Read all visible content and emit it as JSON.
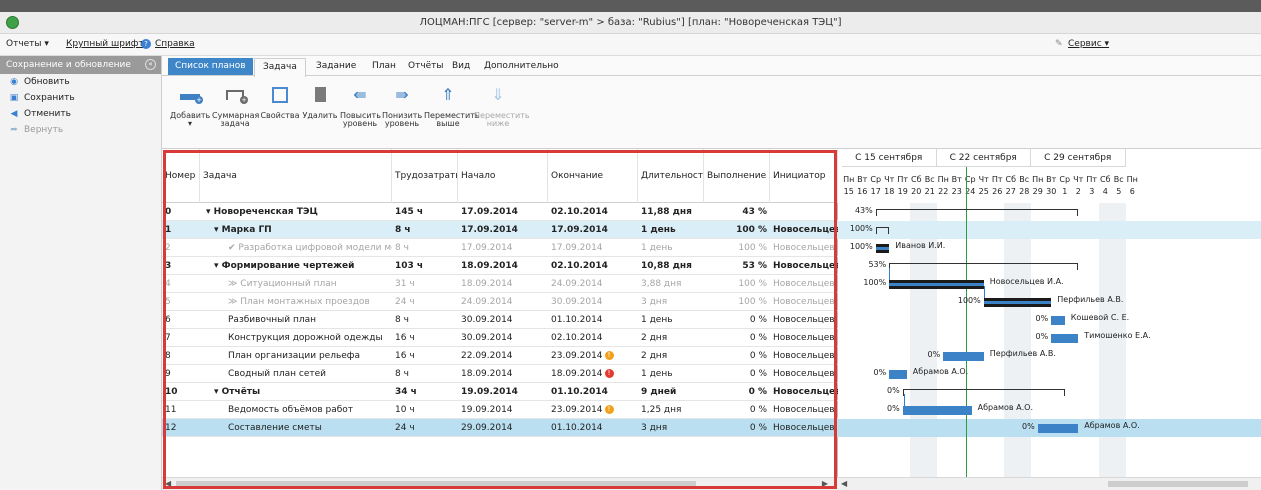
{
  "window": {
    "title": "ЛОЦМАН:ПГС   [сервер: \"server-m\" > база: \"Rubius\"]    [план: \"Новореченская ТЭЦ\"]"
  },
  "menubar": {
    "reports": "Отчеты ▾",
    "large_font": "Крупный шрифт",
    "help": "Справка",
    "service": "Сервис ▾"
  },
  "left_panel": {
    "header": "Сохранение и обновление",
    "items": [
      {
        "label": "Обновить",
        "icon": "refresh-icon"
      },
      {
        "label": "Сохранить",
        "icon": "save-icon"
      },
      {
        "label": "Отменить",
        "icon": "undo-icon"
      },
      {
        "label": "Вернуть",
        "icon": "redo-icon"
      }
    ]
  },
  "ribbon": {
    "tabs": [
      "Список планов",
      "Задача",
      "Задание",
      "План",
      "Отчёты",
      "Вид",
      "Дополнительно"
    ],
    "buttons": [
      {
        "l1": "Добавить",
        "l2": "▾"
      },
      {
        "l1": "Суммарная",
        "l2": "задача"
      },
      {
        "l1": "Свойства",
        "l2": ""
      },
      {
        "l1": "Удалить",
        "l2": ""
      },
      {
        "l1": "Повысить",
        "l2": "уровень"
      },
      {
        "l1": "Понизить",
        "l2": "уровень"
      },
      {
        "l1": "Переместить",
        "l2": "выше"
      },
      {
        "l1": "Переместить",
        "l2": "ниже"
      }
    ]
  },
  "grid": {
    "columns": [
      "Номер",
      "Задача",
      "Трудозатраты",
      "Начало",
      "Окончание",
      "Длительность",
      "Выполнение %",
      "Инициатор"
    ],
    "rows": [
      {
        "num": "0",
        "task": "▾ Новореченская ТЭЦ",
        "effort": "145 ч",
        "start": "17.09.2014",
        "end": "02.10.2014",
        "dur": "11,88 дня",
        "pct": "43 %",
        "init": ""
      },
      {
        "num": "1",
        "task": "▾ Марка ГП",
        "effort": "8 ч",
        "start": "17.09.2014",
        "end": "17.09.2014",
        "dur": "1 день",
        "pct": "100 %",
        "init": "Новосельцев"
      },
      {
        "num": "2",
        "task": "✔ Разработка цифровой модели местности",
        "effort": "8 ч",
        "start": "17.09.2014",
        "end": "17.09.2014",
        "dur": "1 день",
        "pct": "100 %",
        "init": "Новосельцев"
      },
      {
        "num": "3",
        "task": "▾ Формирование чертежей",
        "effort": "103 ч",
        "start": "18.09.2014",
        "end": "02.10.2014",
        "dur": "10,88 дня",
        "pct": "53 %",
        "init": "Новосельцев"
      },
      {
        "num": "4",
        "task": "≫ Ситуационный план",
        "effort": "31 ч",
        "start": "18.09.2014",
        "end": "24.09.2014",
        "dur": "3,88 дня",
        "pct": "100 %",
        "init": "Новосельцев"
      },
      {
        "num": "5",
        "task": "≫ План монтажных проездов",
        "effort": "24 ч",
        "start": "24.09.2014",
        "end": "30.09.2014",
        "dur": "3 дня",
        "pct": "100 %",
        "init": "Новосельцев"
      },
      {
        "num": "6",
        "task": "Разбивочный план",
        "effort": "8 ч",
        "start": "30.09.2014",
        "end": "01.10.2014",
        "dur": "1 день",
        "pct": "0 %",
        "init": "Новосельцев"
      },
      {
        "num": "7",
        "task": "Конструкция дорожной одежды",
        "effort": "16 ч",
        "start": "30.09.2014",
        "end": "02.10.2014",
        "dur": "2 дня",
        "pct": "0 %",
        "init": "Новосельцев"
      },
      {
        "num": "8",
        "task": "План организации рельефа",
        "effort": "16 ч",
        "start": "22.09.2014",
        "end": "23.09.2014",
        "dur": "2 дня",
        "pct": "0 %",
        "init": "Новосельцев"
      },
      {
        "num": "9",
        "task": "Сводный план сетей",
        "effort": "8 ч",
        "start": "18.09.2014",
        "end": "18.09.2014",
        "dur": "1 день",
        "pct": "0 %",
        "init": "Новосельцев"
      },
      {
        "num": "10",
        "task": "▾ Отчёты",
        "effort": "34 ч",
        "start": "19.09.2014",
        "end": "01.10.2014",
        "dur": "9 дней",
        "pct": "0 %",
        "init": "Новосельцев"
      },
      {
        "num": "11",
        "task": "Ведомость объёмов работ",
        "effort": "10 ч",
        "start": "19.09.2014",
        "end": "23.09.2014",
        "dur": "1,25 дня",
        "pct": "0 %",
        "init": "Новосельцев"
      },
      {
        "num": "12",
        "task": "Составление сметы",
        "effort": "24 ч",
        "start": "29.09.2014",
        "end": "01.10.2014",
        "dur": "3 дня",
        "pct": "0 %",
        "init": "Новосельцев"
      }
    ]
  },
  "gantt": {
    "weeks": [
      "С 15 сентября",
      "С 22 сентября",
      "С 29 сентября"
    ],
    "day_names": [
      "Пн",
      "Вт",
      "Ср",
      "Чт",
      "Пт",
      "Сб",
      "Вс",
      "Пн",
      "Вт",
      "Ср",
      "Чт",
      "Пт",
      "Сб",
      "Вс",
      "Пн",
      "Вт",
      "Ср",
      "Чт",
      "Пт",
      "Сб",
      "Вс",
      "Пн"
    ],
    "day_nums": [
      "15",
      "16",
      "17",
      "18",
      "19",
      "20",
      "21",
      "22",
      "23",
      "24",
      "25",
      "26",
      "27",
      "28",
      "29",
      "30",
      "1",
      "2",
      "3",
      "4",
      "5",
      "6"
    ],
    "pct_labels": [
      "43%",
      "100%",
      "100%",
      "53%",
      "100%",
      "100%",
      "0%",
      "0%",
      "0%",
      "0%",
      "0%",
      "0%",
      "0%"
    ],
    "resources": [
      "Иванов И.И.",
      "Новосельцев И.А.",
      "Перфильев А.В.",
      "Кошевой С. Е.",
      "Тимошенко Е.А.",
      "Перфильев А.В.",
      "Абрамов А.О.",
      "Абрамов А.О.",
      "Абрамов А.О."
    ]
  },
  "colors": {
    "accent": "#3f86c8",
    "bar": "#3b82c6",
    "selection": "#b9dff0",
    "highlight_box": "#d83a3a",
    "today": "#2e9b3c"
  }
}
